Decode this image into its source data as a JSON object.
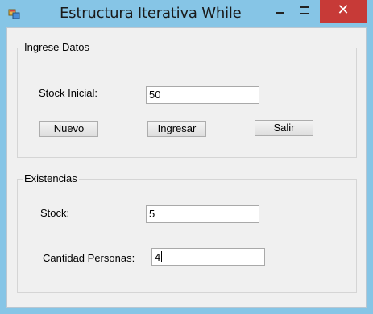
{
  "window": {
    "title": "Estructura Iterativa While",
    "close_glyph": "✕",
    "icon": "app-window-icon"
  },
  "ingrese": {
    "group_label": "Ingrese Datos",
    "stock_inicial_label": "Stock Inicial:",
    "stock_inicial_value": "50",
    "nuevo_label": "Nuevo",
    "ingresar_label": "Ingresar",
    "salir_label": "Salir"
  },
  "existencias": {
    "group_label": "Existencias",
    "stock_label": "Stock:",
    "stock_value": "5",
    "cantidad_label": "Cantidad Personas:",
    "cantidad_value": "4"
  }
}
